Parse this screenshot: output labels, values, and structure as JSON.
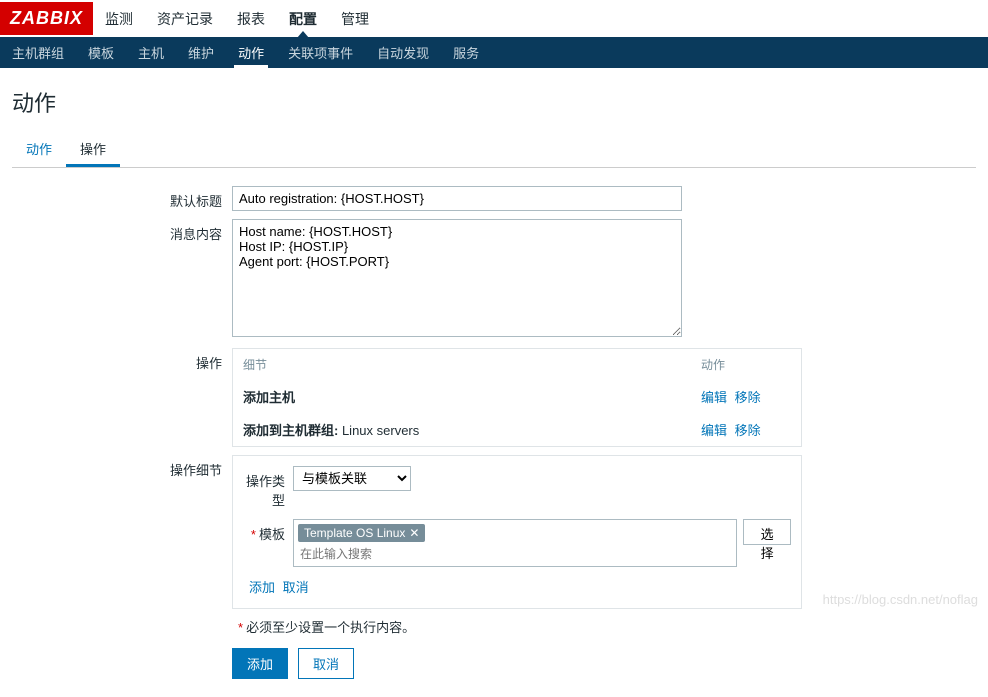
{
  "logo": "ZABBIX",
  "topnav": {
    "items": [
      {
        "label": "监测"
      },
      {
        "label": "资产记录"
      },
      {
        "label": "报表"
      },
      {
        "label": "配置",
        "active": true
      },
      {
        "label": "管理"
      }
    ]
  },
  "subnav": {
    "items": [
      {
        "label": "主机群组"
      },
      {
        "label": "模板"
      },
      {
        "label": "主机"
      },
      {
        "label": "维护"
      },
      {
        "label": "动作",
        "active": true
      },
      {
        "label": "关联项事件"
      },
      {
        "label": "自动发现"
      },
      {
        "label": "服务"
      }
    ]
  },
  "page": {
    "title": "动作"
  },
  "tabs": [
    {
      "label": "动作"
    },
    {
      "label": "操作",
      "active": true
    }
  ],
  "form": {
    "default_subject_label": "默认标题",
    "default_subject_value": "Auto registration: {HOST.HOST}",
    "message_label": "消息内容",
    "message_value": "Host name: {HOST.HOST}\nHost IP: {HOST.IP}\nAgent port: {HOST.PORT}",
    "ops_label": "操作",
    "ops_header_detail": "细节",
    "ops_header_action": "动作",
    "ops_rows": [
      {
        "detail_bold": "添加主机",
        "detail_rest": "",
        "edit": "编辑",
        "remove": "移除"
      },
      {
        "detail_bold": "添加到主机群组:",
        "detail_rest": " Linux servers",
        "edit": "编辑",
        "remove": "移除"
      }
    ],
    "op_detail_label": "操作细节",
    "op_type_label": "操作类型",
    "op_type_value": "与模板关联",
    "template_label": "模板",
    "template_tag": "Template OS Linux",
    "template_search_placeholder": "在此输入搜索",
    "select_button": "选择",
    "add_link": "添加",
    "cancel_link": "取消",
    "hint": "必须至少设置一个执行内容。",
    "add_button": "添加",
    "cancel_button": "取消"
  },
  "watermark": "https://blog.csdn.net/noflag"
}
